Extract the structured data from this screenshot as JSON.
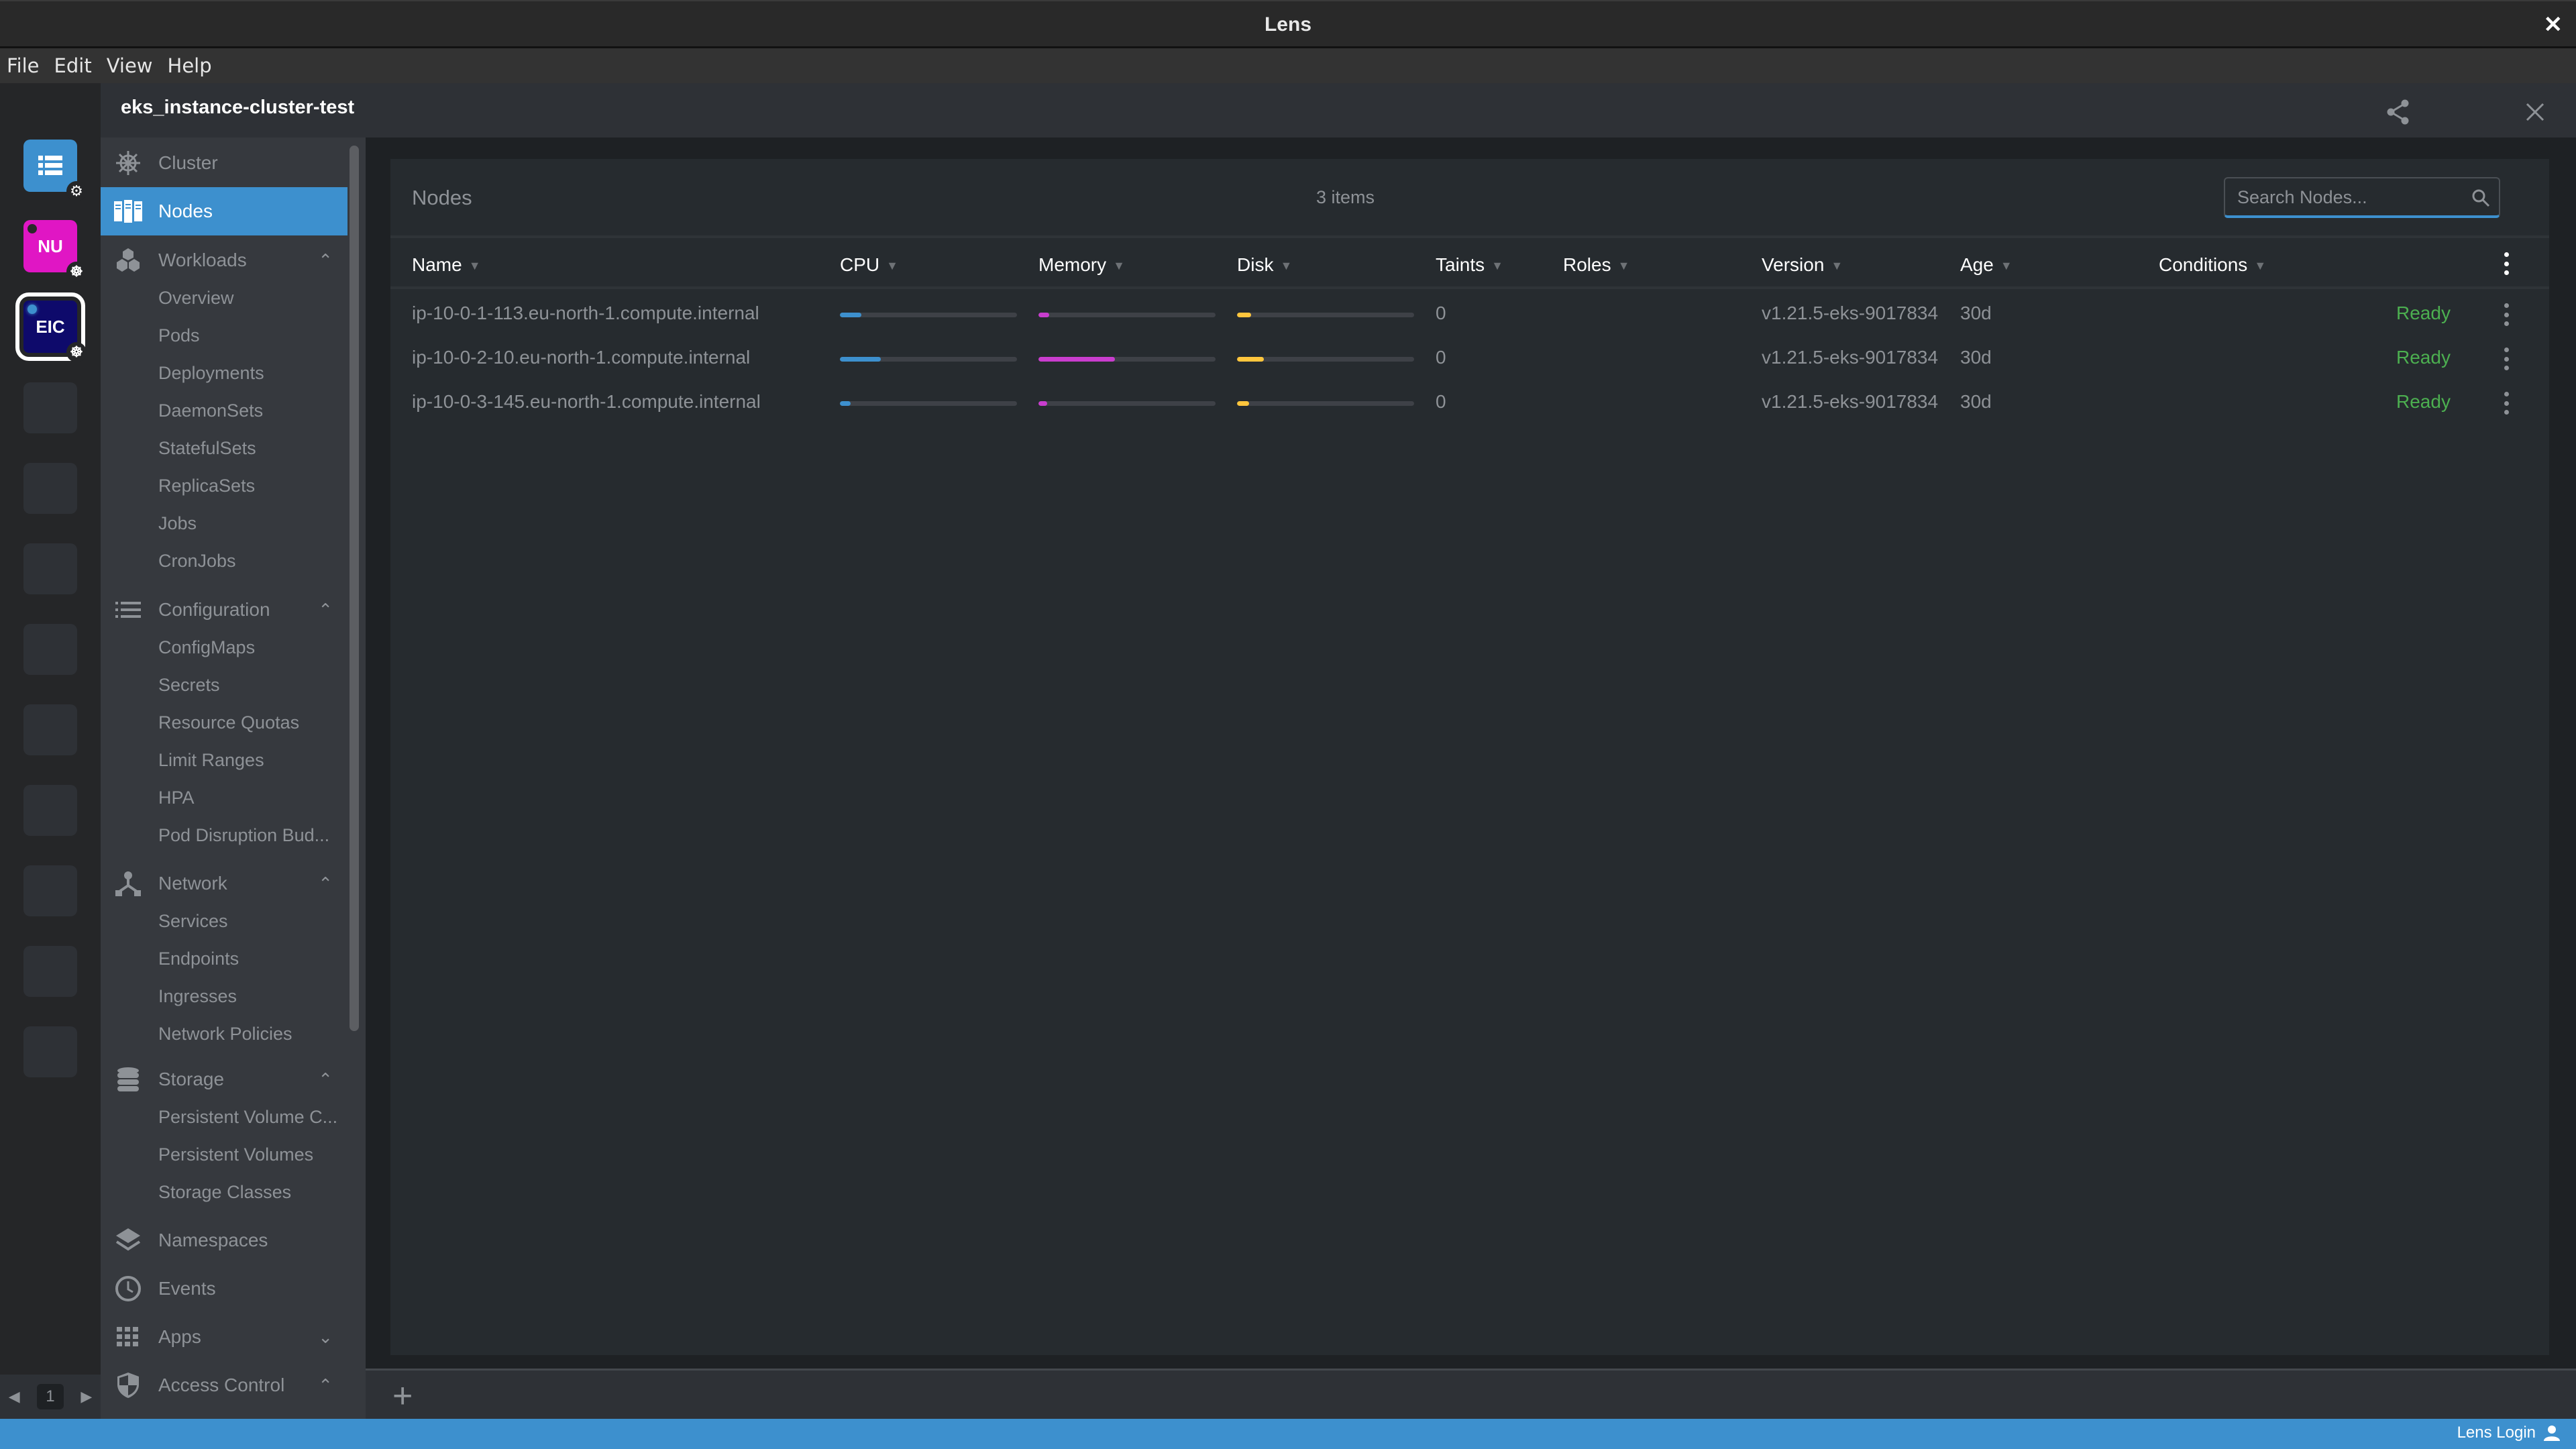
{
  "window": {
    "title": "Lens"
  },
  "menu": [
    "File",
    "Edit",
    "View",
    "Help"
  ],
  "hotbar": {
    "items": [
      {
        "label": "",
        "icon": "catalog-icon",
        "badge": "gear-icon",
        "color": "#3d90ce"
      },
      {
        "label": "NU",
        "badge": "kubernetes-icon",
        "color": "#e016c4",
        "status": "disconnected"
      },
      {
        "label": "EIC",
        "badge": "kubernetes-icon",
        "color": "#0e0a6b",
        "status": "connected",
        "active": true
      }
    ],
    "empty_slots": 9,
    "page": "1"
  },
  "cluster": {
    "name": "eks_instance-cluster-test"
  },
  "sidebar": {
    "items": [
      {
        "label": "Cluster",
        "icon": "kubernetes-helm-icon"
      },
      {
        "label": "Nodes",
        "icon": "nodes-icon",
        "active": true
      },
      {
        "label": "Workloads",
        "icon": "workloads-icon",
        "expanded": true,
        "children": [
          "Overview",
          "Pods",
          "Deployments",
          "DaemonSets",
          "StatefulSets",
          "ReplicaSets",
          "Jobs",
          "CronJobs"
        ]
      },
      {
        "label": "Configuration",
        "icon": "list-icon",
        "expanded": true,
        "children": [
          "ConfigMaps",
          "Secrets",
          "Resource Quotas",
          "Limit Ranges",
          "HPA",
          "Pod Disruption Bud..."
        ]
      },
      {
        "label": "Network",
        "icon": "network-icon",
        "expanded": true,
        "children": [
          "Services",
          "Endpoints",
          "Ingresses",
          "Network Policies"
        ]
      },
      {
        "label": "Storage",
        "icon": "database-icon",
        "expanded": true,
        "children": [
          "Persistent Volume C...",
          "Persistent Volumes",
          "Storage Classes"
        ]
      },
      {
        "label": "Namespaces",
        "icon": "layers-icon"
      },
      {
        "label": "Events",
        "icon": "clock-icon"
      },
      {
        "label": "Apps",
        "icon": "apps-grid-icon",
        "expanded": false
      },
      {
        "label": "Access Control",
        "icon": "shield-icon",
        "expanded": true
      }
    ]
  },
  "nodes": {
    "title": "Nodes",
    "count": "3 items",
    "search_placeholder": "Search Nodes...",
    "columns": [
      "Name",
      "CPU",
      "Memory",
      "Disk",
      "Taints",
      "Roles",
      "Version",
      "Age",
      "Conditions"
    ],
    "colors": {
      "cpu": "#3d90ce",
      "memory": "#c93dce",
      "disk": "#ffc63d",
      "ready": "#4caf50"
    },
    "rows": [
      {
        "name": "ip-10-0-1-113.eu-north-1.compute.internal",
        "cpu": 12,
        "memory": 6,
        "disk": 8,
        "taints": "0",
        "roles": "",
        "version": "v1.21.5-eks-9017834",
        "age": "30d",
        "conditions": "Ready"
      },
      {
        "name": "ip-10-0-2-10.eu-north-1.compute.internal",
        "cpu": 23,
        "memory": 43,
        "disk": 15,
        "taints": "0",
        "roles": "",
        "version": "v1.21.5-eks-9017834",
        "age": "30d",
        "conditions": "Ready"
      },
      {
        "name": "ip-10-0-3-145.eu-north-1.compute.internal",
        "cpu": 6,
        "memory": 5,
        "disk": 7,
        "taints": "0",
        "roles": "",
        "version": "v1.21.5-eks-9017834",
        "age": "30d",
        "conditions": "Ready"
      }
    ]
  },
  "status": {
    "login_label": "Lens Login"
  }
}
